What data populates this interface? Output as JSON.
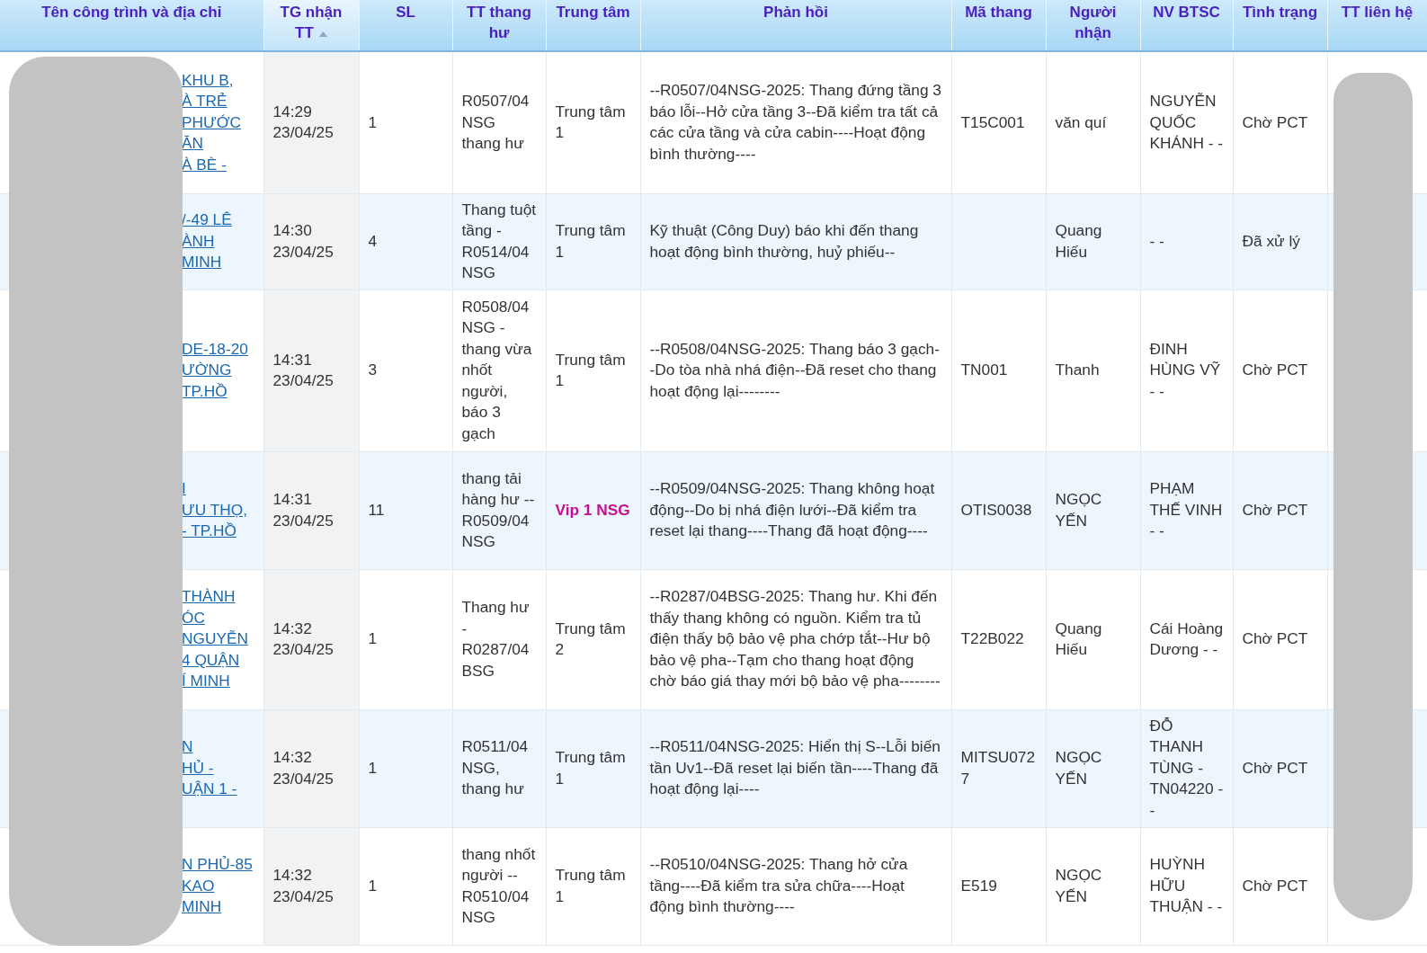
{
  "table": {
    "columns": [
      {
        "label": "Tên công trình và địa chỉ",
        "sorted": false
      },
      {
        "label": "TG nhận TT",
        "sorted": true
      },
      {
        "label": "SL",
        "sorted": false
      },
      {
        "label": "TT thang hư",
        "sorted": false
      },
      {
        "label": "Trung tâm",
        "sorted": false
      },
      {
        "label": "Phản hồi",
        "sorted": false
      },
      {
        "label": "Mã thang",
        "sorted": false
      },
      {
        "label": "Người nhận",
        "sorted": false
      },
      {
        "label": "NV BTSC",
        "sorted": false
      },
      {
        "label": "Tình trạng",
        "sorted": false
      },
      {
        "label": "TT liên hệ",
        "sorted": false
      }
    ],
    "rows": [
      {
        "name_fragments": [
          "KHU B,",
          "À TRẺ",
          "PHƯỚC",
          "ĂN",
          "À BÈ -"
        ],
        "time": "14:29 23/04/25",
        "qty": "1",
        "fault": "R0507/04 NSG thang hư",
        "center": {
          "text": "Trung tâm 1",
          "kind": "normal"
        },
        "feedback": "--R0507/04NSG-2025: Thang đứng tầng 3 báo lỗi--Hở cửa tầng 3--Đã kiểm tra tất cả các cửa tầng và cửa cabin----Hoạt động bình thường----",
        "code": "T15C001",
        "receiver": "văn quí",
        "staff": "NGUYỄN QUỐC KHÁNH - -",
        "status": "Chờ PCT"
      },
      {
        "name_fragments": [
          "/-49 LÊ",
          "ÀNH",
          "MINH"
        ],
        "time": "14:30 23/04/25",
        "qty": "4",
        "fault": "Thang tuột tầng - R0514/04 NSG",
        "center": {
          "text": "Trung tâm 1",
          "kind": "normal"
        },
        "feedback": "Kỹ thuật (Công Duy) báo khi đến thang hoạt động bình thường, huỷ phiếu--",
        "receiver": "Quang Hiếu",
        "staff": "- -",
        "status": "Đã xử lý"
      },
      {
        "name_fragments": [
          "DE-18-20",
          "ƯỜNG",
          "TP.HỒ"
        ],
        "time": "14:31 23/04/25",
        "qty": "3",
        "fault": "R0508/04 NSG - thang vừa nhốt người, báo 3 gạch",
        "center": {
          "text": "Trung tâm 1",
          "kind": "normal"
        },
        "feedback": "--R0508/04NSG-2025: Thang báo 3 gạch--Do tòa nhà nhá điện--Đã reset cho thang hoạt động lại--------",
        "code": "TN001",
        "receiver": "Thanh",
        "staff": "ĐINH HÙNG VỸ - -",
        "status": "Chờ PCT"
      },
      {
        "name_fragments": [
          "I",
          "ƯU THỌ,",
          "- TP.HỒ"
        ],
        "time": "14:31 23/04/25",
        "qty": "11",
        "fault": "thang tải hàng hư -- R0509/04 NSG",
        "center": {
          "text": "Vip 1 NSG",
          "kind": "vip"
        },
        "feedback": "--R0509/04NSG-2025: Thang không hoạt động--Do bị nhá điện lưới--Đã kiểm tra reset lại thang----Thang đã hoạt động----",
        "code": "OTIS0038",
        "receiver": "NGỌC YẾN",
        "staff": "PHẠM THẾ VINH - -",
        "status": "Chờ PCT"
      },
      {
        "name_fragments": [
          "THÀNH",
          "ÓC",
          "NGUYỄN",
          "4 QUẬN",
          "Í MINH"
        ],
        "time": "14:32 23/04/25",
        "qty": "1",
        "fault": "Thang hư - R0287/04 BSG",
        "center": {
          "text": "Trung tâm 2",
          "kind": "normal"
        },
        "feedback": "--R0287/04BSG-2025: Thang hư. Khi đến thấy thang không có nguồn. Kiểm tra tủ điện thấy bộ bảo vệ pha chớp tắt--Hư bộ bảo vệ pha--Tạm cho thang hoạt động chờ báo giá thay mới bộ bảo vệ pha--------",
        "code": "T22B022",
        "receiver": "Quang Hiếu",
        "staff": "Cái Hoàng Dương - -",
        "status": "Chờ PCT"
      },
      {
        "name_fragments": [
          "N",
          "HỦ -",
          "UẬN 1 -"
        ],
        "time": "14:32 23/04/25",
        "qty": "1",
        "fault": "R0511/04 NSG, thang hư",
        "center": {
          "text": "Trung tâm 1",
          "kind": "normal"
        },
        "feedback": "--R0511/04NSG-2025: Hiển thị S--Lỗi biến tần Uv1--Đã reset lại biến tần----Thang đã hoạt động lại----",
        "code": "MITSU0727",
        "receiver": "NGỌC YẾN",
        "staff": "ĐỖ THANH TÙNG - TN04220 - -",
        "status": "Chờ PCT"
      },
      {
        "name_fragments": [
          "N PHỦ-85",
          "KAO",
          "MINH"
        ],
        "time": "14:32 23/04/25",
        "qty": "1",
        "fault": "thang nhốt người -- R0510/04 NSG",
        "center": {
          "text": "Trung tâm 1",
          "kind": "normal"
        },
        "feedback": "--R0510/04NSG-2025: Thang hở cửa tầng----Đã kiểm tra sửa chữa----Hoạt động bình thường----",
        "code": "E519",
        "receiver": "NGỌC YẾN",
        "staff": "HUỲNH HỮU THUẬN - -",
        "status": "Chờ PCT"
      }
    ]
  }
}
